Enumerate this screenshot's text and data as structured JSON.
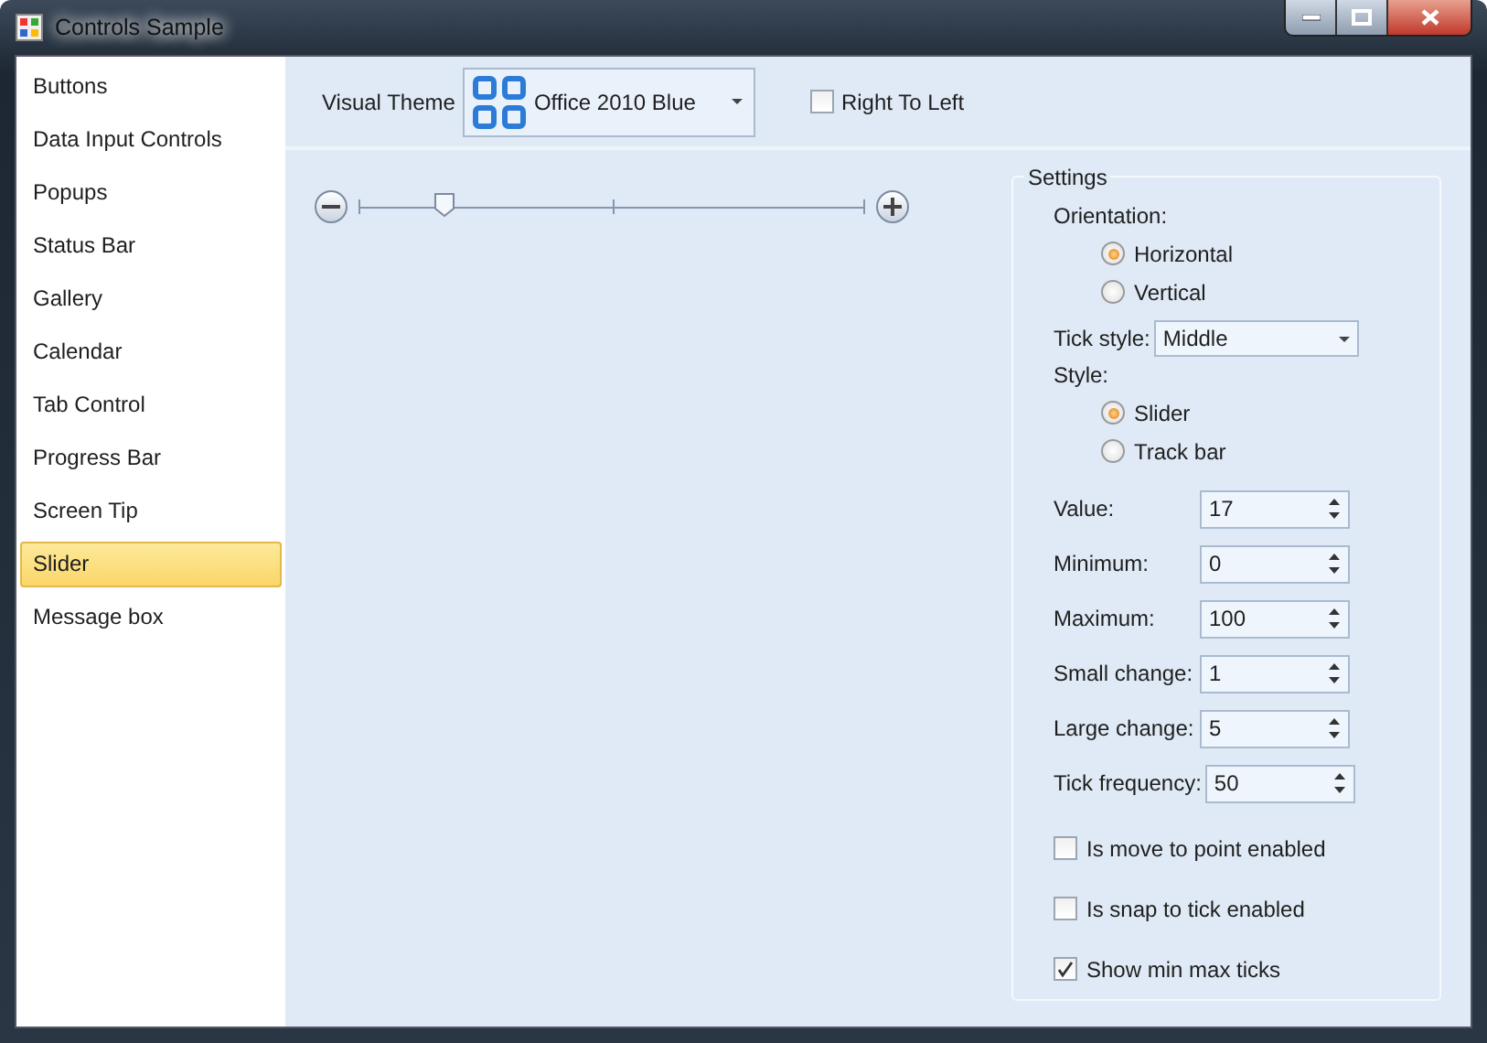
{
  "window": {
    "title": "Controls Sample"
  },
  "sidebar": {
    "items": [
      {
        "label": "Buttons",
        "selected": false
      },
      {
        "label": "Data Input Controls",
        "selected": false
      },
      {
        "label": "Popups",
        "selected": false
      },
      {
        "label": "Status Bar",
        "selected": false
      },
      {
        "label": "Gallery",
        "selected": false
      },
      {
        "label": "Calendar",
        "selected": false
      },
      {
        "label": "Tab Control",
        "selected": false
      },
      {
        "label": "Progress Bar",
        "selected": false
      },
      {
        "label": "Screen Tip",
        "selected": false
      },
      {
        "label": "Slider",
        "selected": true
      },
      {
        "label": "Message box",
        "selected": false
      }
    ]
  },
  "theme": {
    "label": "Visual Theme",
    "value": "Office 2010 Blue"
  },
  "right_to_left": {
    "label": "Right To Left",
    "checked": false
  },
  "slider": {
    "level": 0.17
  },
  "settings": {
    "title": "Settings",
    "orientation": {
      "label": "Orientation:",
      "options": [
        {
          "label": "Horizontal",
          "selected": true
        },
        {
          "label": "Vertical",
          "selected": false
        }
      ]
    },
    "tick_style": {
      "label": "Tick style:",
      "value": "Middle"
    },
    "style": {
      "label": "Style:",
      "options": [
        {
          "label": "Slider",
          "selected": true
        },
        {
          "label": "Track bar",
          "selected": false
        }
      ]
    },
    "fields": [
      {
        "label": "Value:",
        "value": "17"
      },
      {
        "label": "Minimum:",
        "value": "0"
      },
      {
        "label": "Maximum:",
        "value": "100"
      },
      {
        "label": "Small change:",
        "value": "1"
      },
      {
        "label": "Large change:",
        "value": "5"
      },
      {
        "label": "Tick frequency:",
        "value": "50"
      }
    ],
    "checkboxes": [
      {
        "label": "Is move to point enabled",
        "checked": false
      },
      {
        "label": "Is snap to tick enabled",
        "checked": false
      },
      {
        "label": "Show min max ticks",
        "checked": true
      }
    ]
  }
}
